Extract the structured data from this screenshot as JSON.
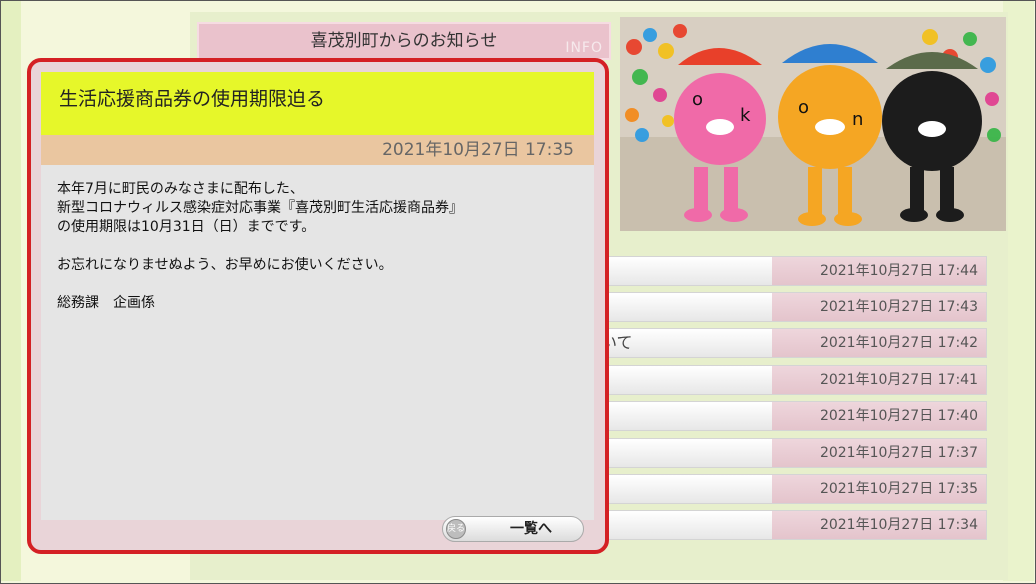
{
  "header": {
    "title": "喜茂別町からのお知らせ",
    "info_tag": "INFO"
  },
  "news_list": [
    {
      "text": "",
      "date": "2021年10月27日  17:44"
    },
    {
      "text": "",
      "date": "2021年10月27日  17:43"
    },
    {
      "text": "いて",
      "date": "2021年10月27日  17:42"
    },
    {
      "text": "",
      "date": "2021年10月27日  17:41"
    },
    {
      "text": "",
      "date": "2021年10月27日  17:40"
    },
    {
      "text": "",
      "date": "2021年10月27日  17:37"
    },
    {
      "text": "",
      "date": "2021年10月27日  17:35"
    },
    {
      "text": "",
      "date": "2021年10月27日  17:34"
    }
  ],
  "popup": {
    "headline": "生活応援商品券の使用期限迫る",
    "datetime": "2021年10月27日  17:35",
    "body": [
      "本年7月に町民のみなさまに配布した、",
      "新型コロナウィルス感染症対応事業『喜茂別町生活応援商品券』",
      "の使用期限は10月31日（日）までです。",
      "",
      "お忘れになりませぬよう、お早めにお使いください。",
      "",
      "総務課　企画係"
    ],
    "list_button": "一覧へ",
    "list_button_icon_text": "戻る"
  },
  "colors": {
    "popup_border": "#d42024",
    "headline_bg": "#e6f72a",
    "datebar_bg": "#eac6a0"
  }
}
